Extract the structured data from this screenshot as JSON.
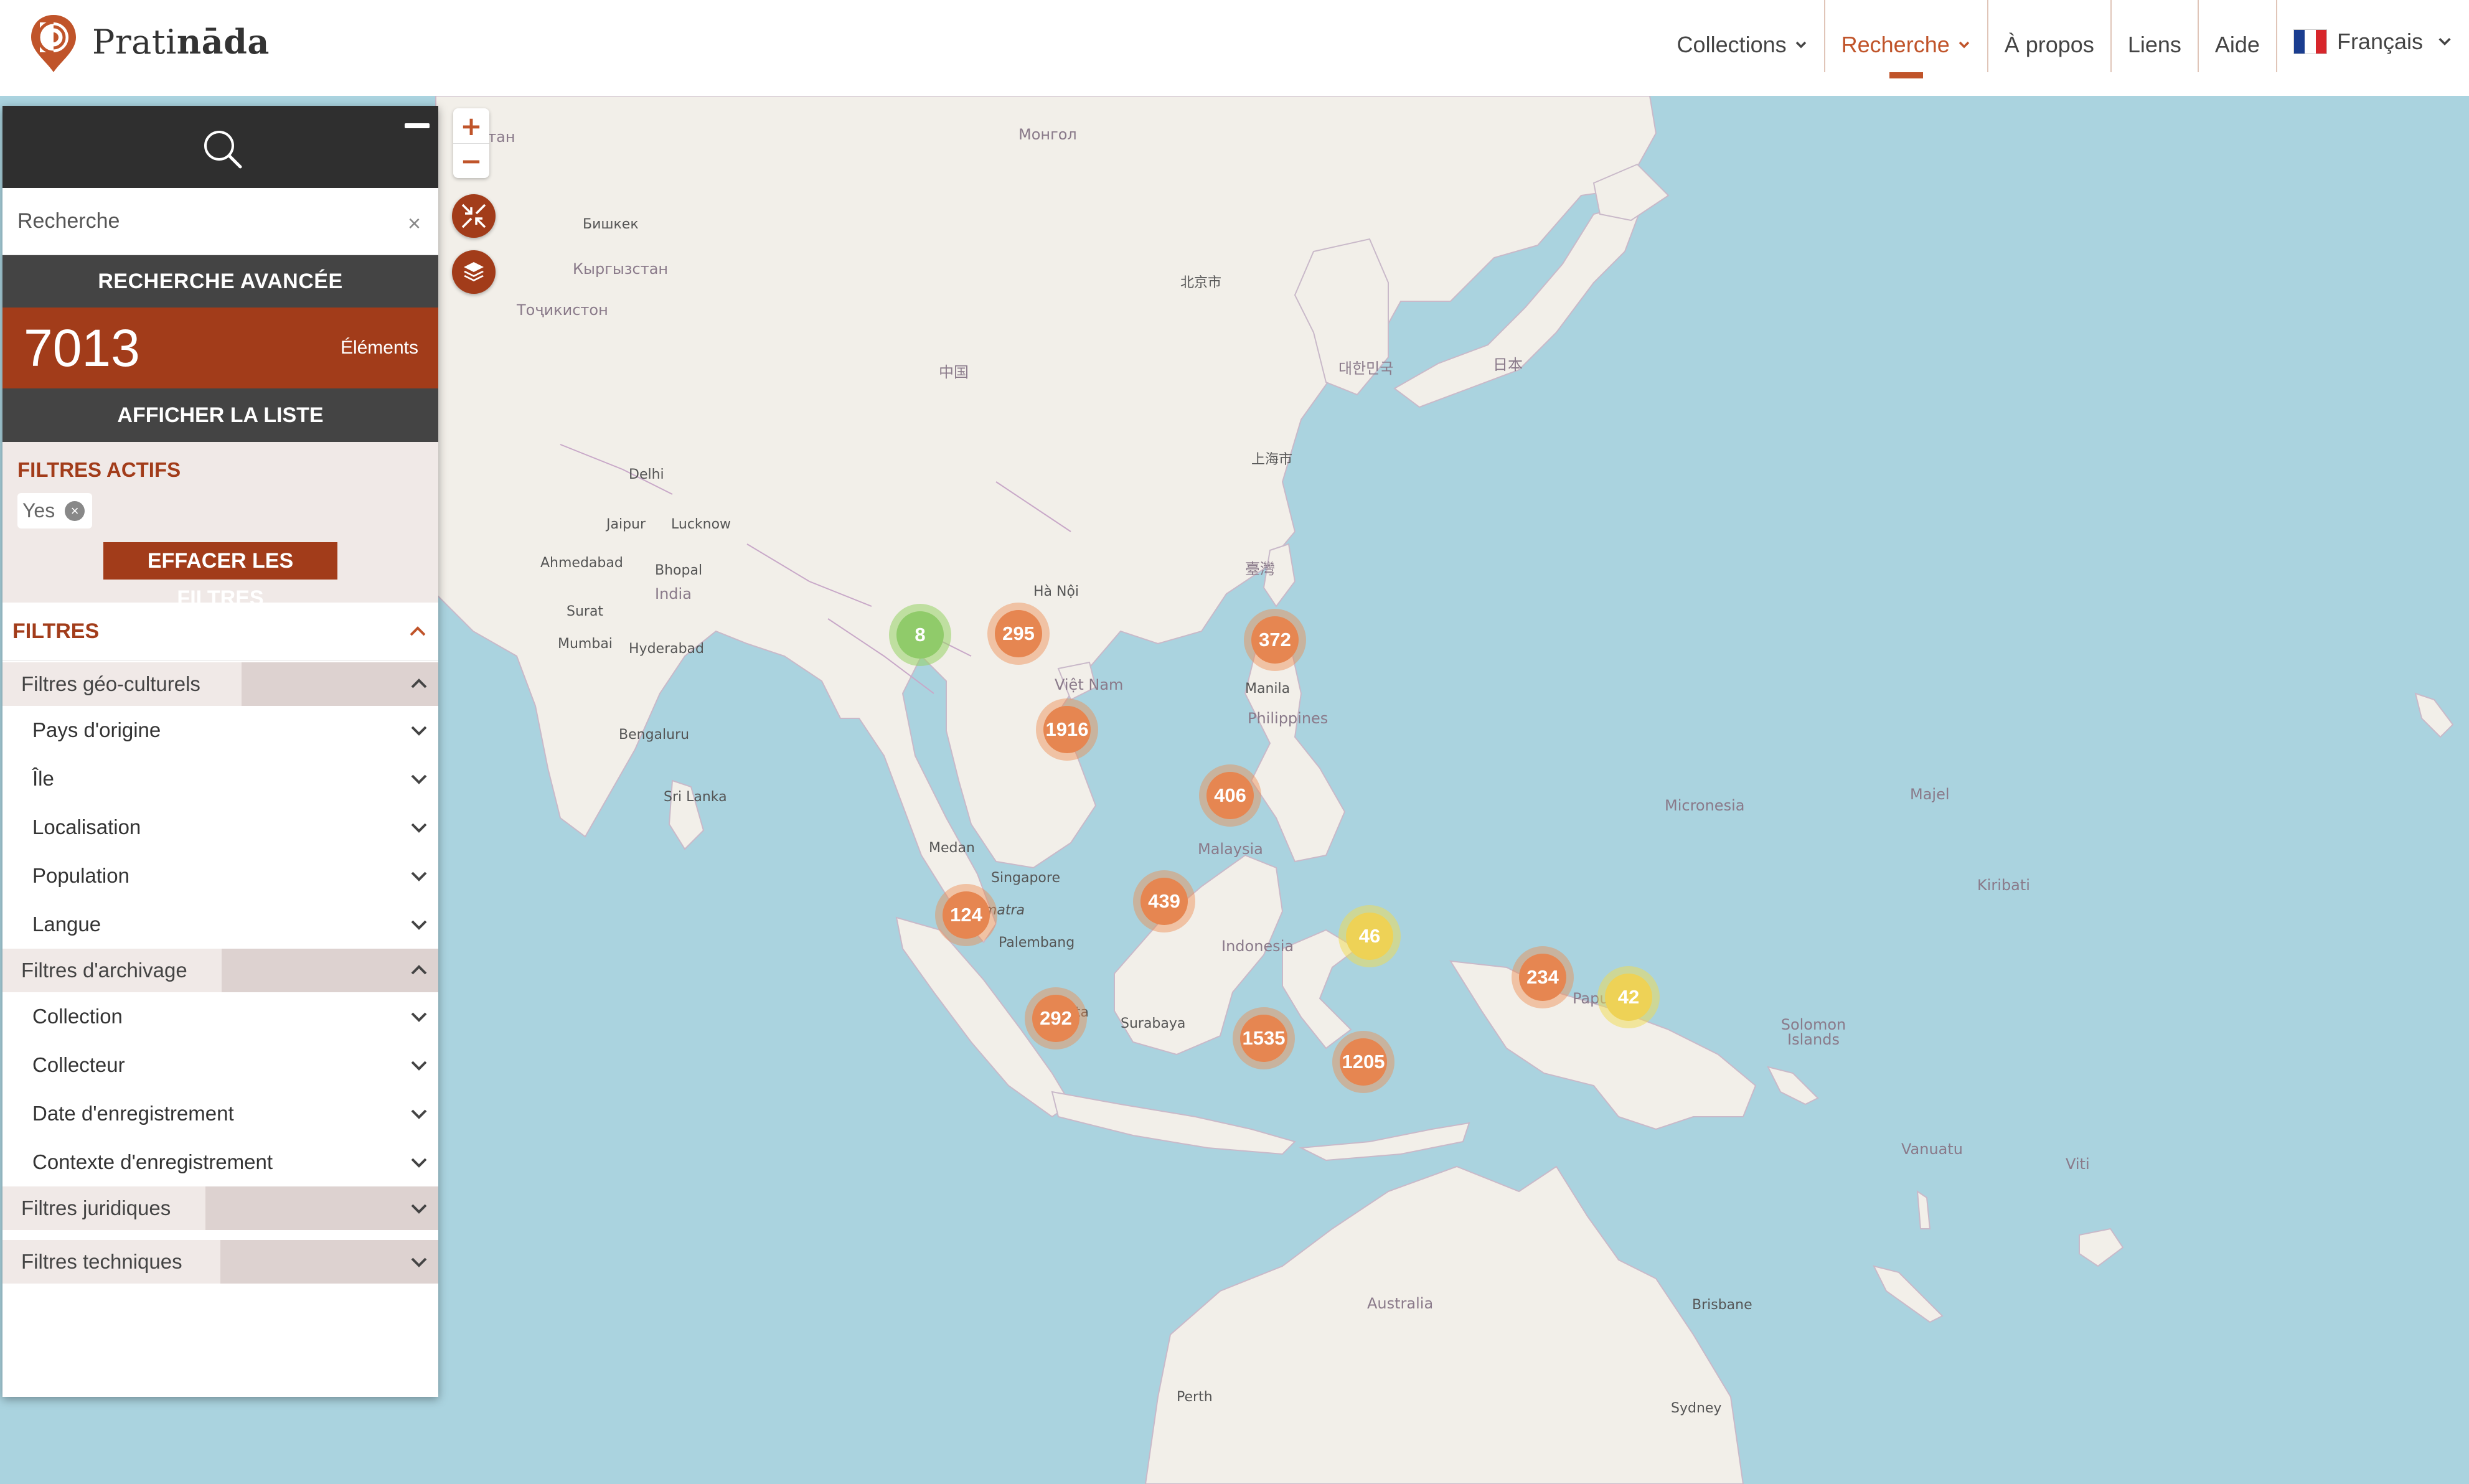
{
  "brand": {
    "name_prefix": "Prati",
    "name_suffix": "nāda",
    "accent": "#c0542a",
    "dark_accent": "#a23c1a"
  },
  "nav": {
    "items": [
      {
        "label": "Collections",
        "dropdown": true,
        "active": false
      },
      {
        "label": "Recherche",
        "dropdown": true,
        "active": true
      },
      {
        "label": "À propos",
        "dropdown": false,
        "active": false
      },
      {
        "label": "Liens",
        "dropdown": false,
        "active": false
      },
      {
        "label": "Aide",
        "dropdown": false,
        "active": false
      }
    ],
    "language": "Français"
  },
  "sidebar": {
    "search_placeholder": "Recherche",
    "advanced_label": "RECHERCHE AVANCÉE",
    "count_value": "7013",
    "count_label": "Éléments",
    "list_label": "AFFICHER LA LISTE",
    "active_filters_title": "FILTRES ACTIFS",
    "active_chip": "Yes",
    "clear_filters_label": "EFFACER LES FILTRES",
    "filters_title": "FILTRES",
    "sections": [
      {
        "label": "Filtres géo-culturels",
        "expanded": true,
        "items": [
          "Pays d'origine",
          "Île",
          "Localisation",
          "Population",
          "Langue"
        ]
      },
      {
        "label": "Filtres d'archivage",
        "expanded": true,
        "items": [
          "Collection",
          "Collecteur",
          "Date d'enregistrement",
          "Contexte d'enregistrement"
        ]
      },
      {
        "label": "Filtres juridiques",
        "expanded": false,
        "items": []
      },
      {
        "label": "Filtres techniques",
        "expanded": false,
        "items": []
      }
    ]
  },
  "map": {
    "zoom_in": "+",
    "zoom_out": "−",
    "clusters": [
      {
        "count": "8",
        "color": "green"
      },
      {
        "count": "295",
        "color": "orange"
      },
      {
        "count": "372",
        "color": "orange"
      },
      {
        "count": "1916",
        "color": "orange"
      },
      {
        "count": "406",
        "color": "orange"
      },
      {
        "count": "124",
        "color": "orange"
      },
      {
        "count": "439",
        "color": "orange"
      },
      {
        "count": "46",
        "color": "yellow"
      },
      {
        "count": "234",
        "color": "orange"
      },
      {
        "count": "42",
        "color": "yellow"
      },
      {
        "count": "292",
        "color": "orange"
      },
      {
        "count": "1535",
        "color": "orange"
      },
      {
        "count": "1205",
        "color": "orange"
      }
    ],
    "labels": {
      "india": "India",
      "delhi": "Delhi",
      "lucknow": "Lucknow",
      "jaipur": "Jaipur",
      "ahmedabad": "Ahmedabad",
      "bhopal": "Bhopal",
      "surat": "Surat",
      "mumbai": "Mumbai",
      "hyderabad": "Hyderabad",
      "bengaluru": "Bengaluru",
      "srilanka": "Sri Lanka",
      "china": "中国",
      "mongolia": "Монгол",
      "kazakh": "стан",
      "bishkek": "Бишкек",
      "kyrgyz": "Кыргызстан",
      "tajik": "Тоҷикистон",
      "vietnam": "Việt Nam",
      "hanoi": "Hà Nội",
      "manila": "Manila",
      "philippines": "Philippines",
      "malaysia": "Malaysia",
      "singapore": "Singapore",
      "medan": "Medan",
      "sumatra": "Sumatra",
      "palembang": "Palembang",
      "jakarta": "Jakarta",
      "surabaya": "Surabaya",
      "indonesia": "Indonesia",
      "papua": "Papua",
      "micronesia": "Micronesia",
      "majuro": "Majel",
      "kiribati": "Kiribati",
      "solomon": "Solomon Islands",
      "vanuatu": "Vanuatu",
      "fiji": "Viti",
      "australia": "Australia",
      "brisbane": "Brisbane",
      "sydney": "Sydney",
      "perth": "Perth",
      "korea": "대한민국",
      "japan": "日本",
      "beijing": "北京市",
      "shanghai": "上海市",
      "taiwan": "臺灣"
    }
  }
}
